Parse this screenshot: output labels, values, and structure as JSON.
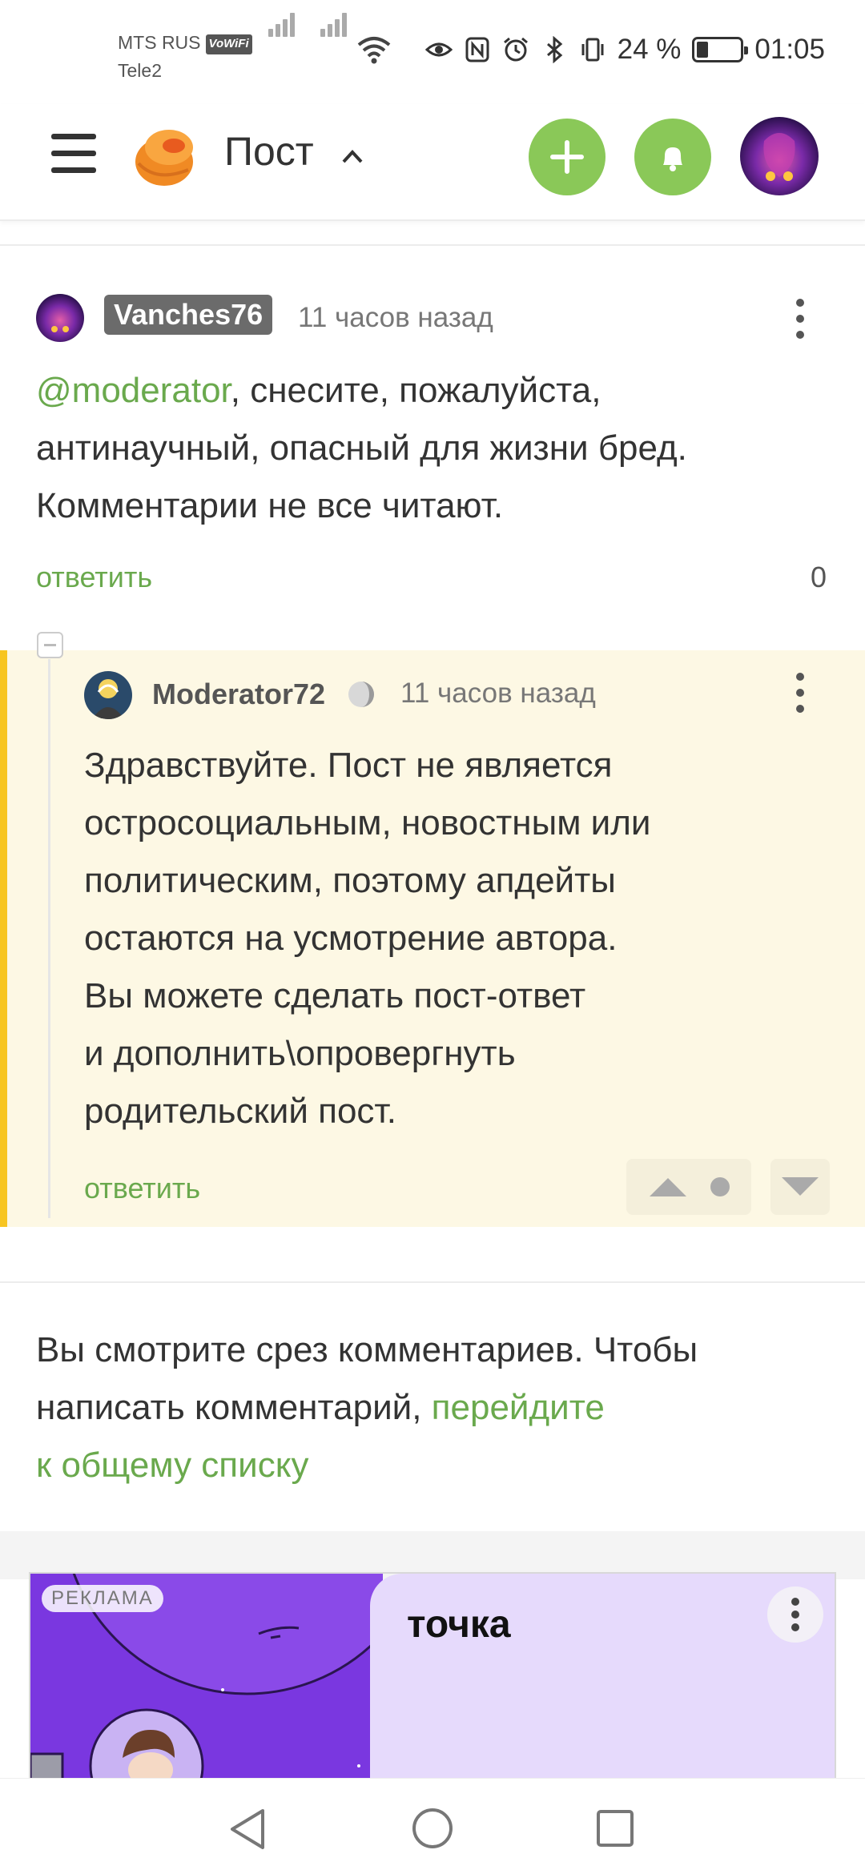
{
  "status_bar": {
    "carrier1": "MTS RUS",
    "vowifi": "VoWiFi",
    "carrier2": "Tele2",
    "battery": "24 %",
    "battery_level": 0.24,
    "time": "01:05"
  },
  "header": {
    "title": "Пост"
  },
  "comments": [
    {
      "username": "Vanches76",
      "time": "11 часов назад",
      "mention": "@moderator",
      "line1": ", снесите, пожалуйста,",
      "line2": "антинаучный, опасный для жизни бред.",
      "line3": "Комментарии не все читают.",
      "reply": "ответить",
      "score": "0"
    },
    {
      "username": "Moderator72",
      "time": "11 часов назад",
      "lines": [
        "Здравствуйте. Пост не является",
        "остросоциальным, новостным или",
        "политическим, поэтому апдейты",
        "остаются на усмотрение автора.",
        "Вы можете сделать пост-ответ",
        "и дополнить\\опровергнуть",
        "родительский пост."
      ],
      "reply": "ответить"
    }
  ],
  "notice": {
    "text_line1": "Вы смотрите срез комментариев. Чтобы",
    "text_line2": "написать комментарий, ",
    "link_part1": "перейдите",
    "link_part2": "к общему списку"
  },
  "ad": {
    "label": "РЕКЛАМА",
    "brand": "точка"
  },
  "colors": {
    "accent_green": "#8ac858",
    "link_green": "#6aa94d",
    "moderator_bar": "#f7c521",
    "reply_bg": "#fdf8e4"
  }
}
